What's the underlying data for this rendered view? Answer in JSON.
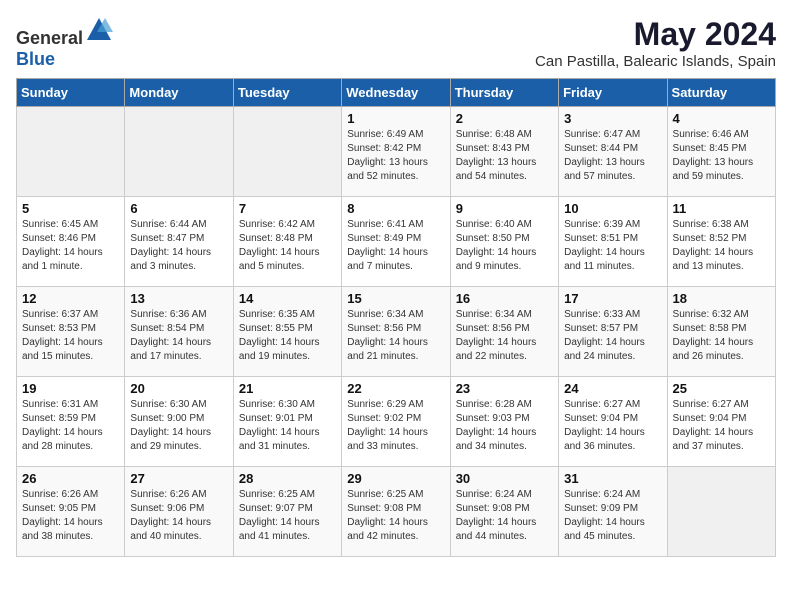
{
  "logo": {
    "text_general": "General",
    "text_blue": "Blue"
  },
  "title": "May 2024",
  "subtitle": "Can Pastilla, Balearic Islands, Spain",
  "days_of_week": [
    "Sunday",
    "Monday",
    "Tuesday",
    "Wednesday",
    "Thursday",
    "Friday",
    "Saturday"
  ],
  "weeks": [
    [
      {
        "day": "",
        "info": ""
      },
      {
        "day": "",
        "info": ""
      },
      {
        "day": "",
        "info": ""
      },
      {
        "day": "1",
        "info": "Sunrise: 6:49 AM\nSunset: 8:42 PM\nDaylight: 13 hours\nand 52 minutes."
      },
      {
        "day": "2",
        "info": "Sunrise: 6:48 AM\nSunset: 8:43 PM\nDaylight: 13 hours\nand 54 minutes."
      },
      {
        "day": "3",
        "info": "Sunrise: 6:47 AM\nSunset: 8:44 PM\nDaylight: 13 hours\nand 57 minutes."
      },
      {
        "day": "4",
        "info": "Sunrise: 6:46 AM\nSunset: 8:45 PM\nDaylight: 13 hours\nand 59 minutes."
      }
    ],
    [
      {
        "day": "5",
        "info": "Sunrise: 6:45 AM\nSunset: 8:46 PM\nDaylight: 14 hours\nand 1 minute."
      },
      {
        "day": "6",
        "info": "Sunrise: 6:44 AM\nSunset: 8:47 PM\nDaylight: 14 hours\nand 3 minutes."
      },
      {
        "day": "7",
        "info": "Sunrise: 6:42 AM\nSunset: 8:48 PM\nDaylight: 14 hours\nand 5 minutes."
      },
      {
        "day": "8",
        "info": "Sunrise: 6:41 AM\nSunset: 8:49 PM\nDaylight: 14 hours\nand 7 minutes."
      },
      {
        "day": "9",
        "info": "Sunrise: 6:40 AM\nSunset: 8:50 PM\nDaylight: 14 hours\nand 9 minutes."
      },
      {
        "day": "10",
        "info": "Sunrise: 6:39 AM\nSunset: 8:51 PM\nDaylight: 14 hours\nand 11 minutes."
      },
      {
        "day": "11",
        "info": "Sunrise: 6:38 AM\nSunset: 8:52 PM\nDaylight: 14 hours\nand 13 minutes."
      }
    ],
    [
      {
        "day": "12",
        "info": "Sunrise: 6:37 AM\nSunset: 8:53 PM\nDaylight: 14 hours\nand 15 minutes."
      },
      {
        "day": "13",
        "info": "Sunrise: 6:36 AM\nSunset: 8:54 PM\nDaylight: 14 hours\nand 17 minutes."
      },
      {
        "day": "14",
        "info": "Sunrise: 6:35 AM\nSunset: 8:55 PM\nDaylight: 14 hours\nand 19 minutes."
      },
      {
        "day": "15",
        "info": "Sunrise: 6:34 AM\nSunset: 8:56 PM\nDaylight: 14 hours\nand 21 minutes."
      },
      {
        "day": "16",
        "info": "Sunrise: 6:34 AM\nSunset: 8:56 PM\nDaylight: 14 hours\nand 22 minutes."
      },
      {
        "day": "17",
        "info": "Sunrise: 6:33 AM\nSunset: 8:57 PM\nDaylight: 14 hours\nand 24 minutes."
      },
      {
        "day": "18",
        "info": "Sunrise: 6:32 AM\nSunset: 8:58 PM\nDaylight: 14 hours\nand 26 minutes."
      }
    ],
    [
      {
        "day": "19",
        "info": "Sunrise: 6:31 AM\nSunset: 8:59 PM\nDaylight: 14 hours\nand 28 minutes."
      },
      {
        "day": "20",
        "info": "Sunrise: 6:30 AM\nSunset: 9:00 PM\nDaylight: 14 hours\nand 29 minutes."
      },
      {
        "day": "21",
        "info": "Sunrise: 6:30 AM\nSunset: 9:01 PM\nDaylight: 14 hours\nand 31 minutes."
      },
      {
        "day": "22",
        "info": "Sunrise: 6:29 AM\nSunset: 9:02 PM\nDaylight: 14 hours\nand 33 minutes."
      },
      {
        "day": "23",
        "info": "Sunrise: 6:28 AM\nSunset: 9:03 PM\nDaylight: 14 hours\nand 34 minutes."
      },
      {
        "day": "24",
        "info": "Sunrise: 6:27 AM\nSunset: 9:04 PM\nDaylight: 14 hours\nand 36 minutes."
      },
      {
        "day": "25",
        "info": "Sunrise: 6:27 AM\nSunset: 9:04 PM\nDaylight: 14 hours\nand 37 minutes."
      }
    ],
    [
      {
        "day": "26",
        "info": "Sunrise: 6:26 AM\nSunset: 9:05 PM\nDaylight: 14 hours\nand 38 minutes."
      },
      {
        "day": "27",
        "info": "Sunrise: 6:26 AM\nSunset: 9:06 PM\nDaylight: 14 hours\nand 40 minutes."
      },
      {
        "day": "28",
        "info": "Sunrise: 6:25 AM\nSunset: 9:07 PM\nDaylight: 14 hours\nand 41 minutes."
      },
      {
        "day": "29",
        "info": "Sunrise: 6:25 AM\nSunset: 9:08 PM\nDaylight: 14 hours\nand 42 minutes."
      },
      {
        "day": "30",
        "info": "Sunrise: 6:24 AM\nSunset: 9:08 PM\nDaylight: 14 hours\nand 44 minutes."
      },
      {
        "day": "31",
        "info": "Sunrise: 6:24 AM\nSunset: 9:09 PM\nDaylight: 14 hours\nand 45 minutes."
      },
      {
        "day": "",
        "info": ""
      }
    ]
  ]
}
